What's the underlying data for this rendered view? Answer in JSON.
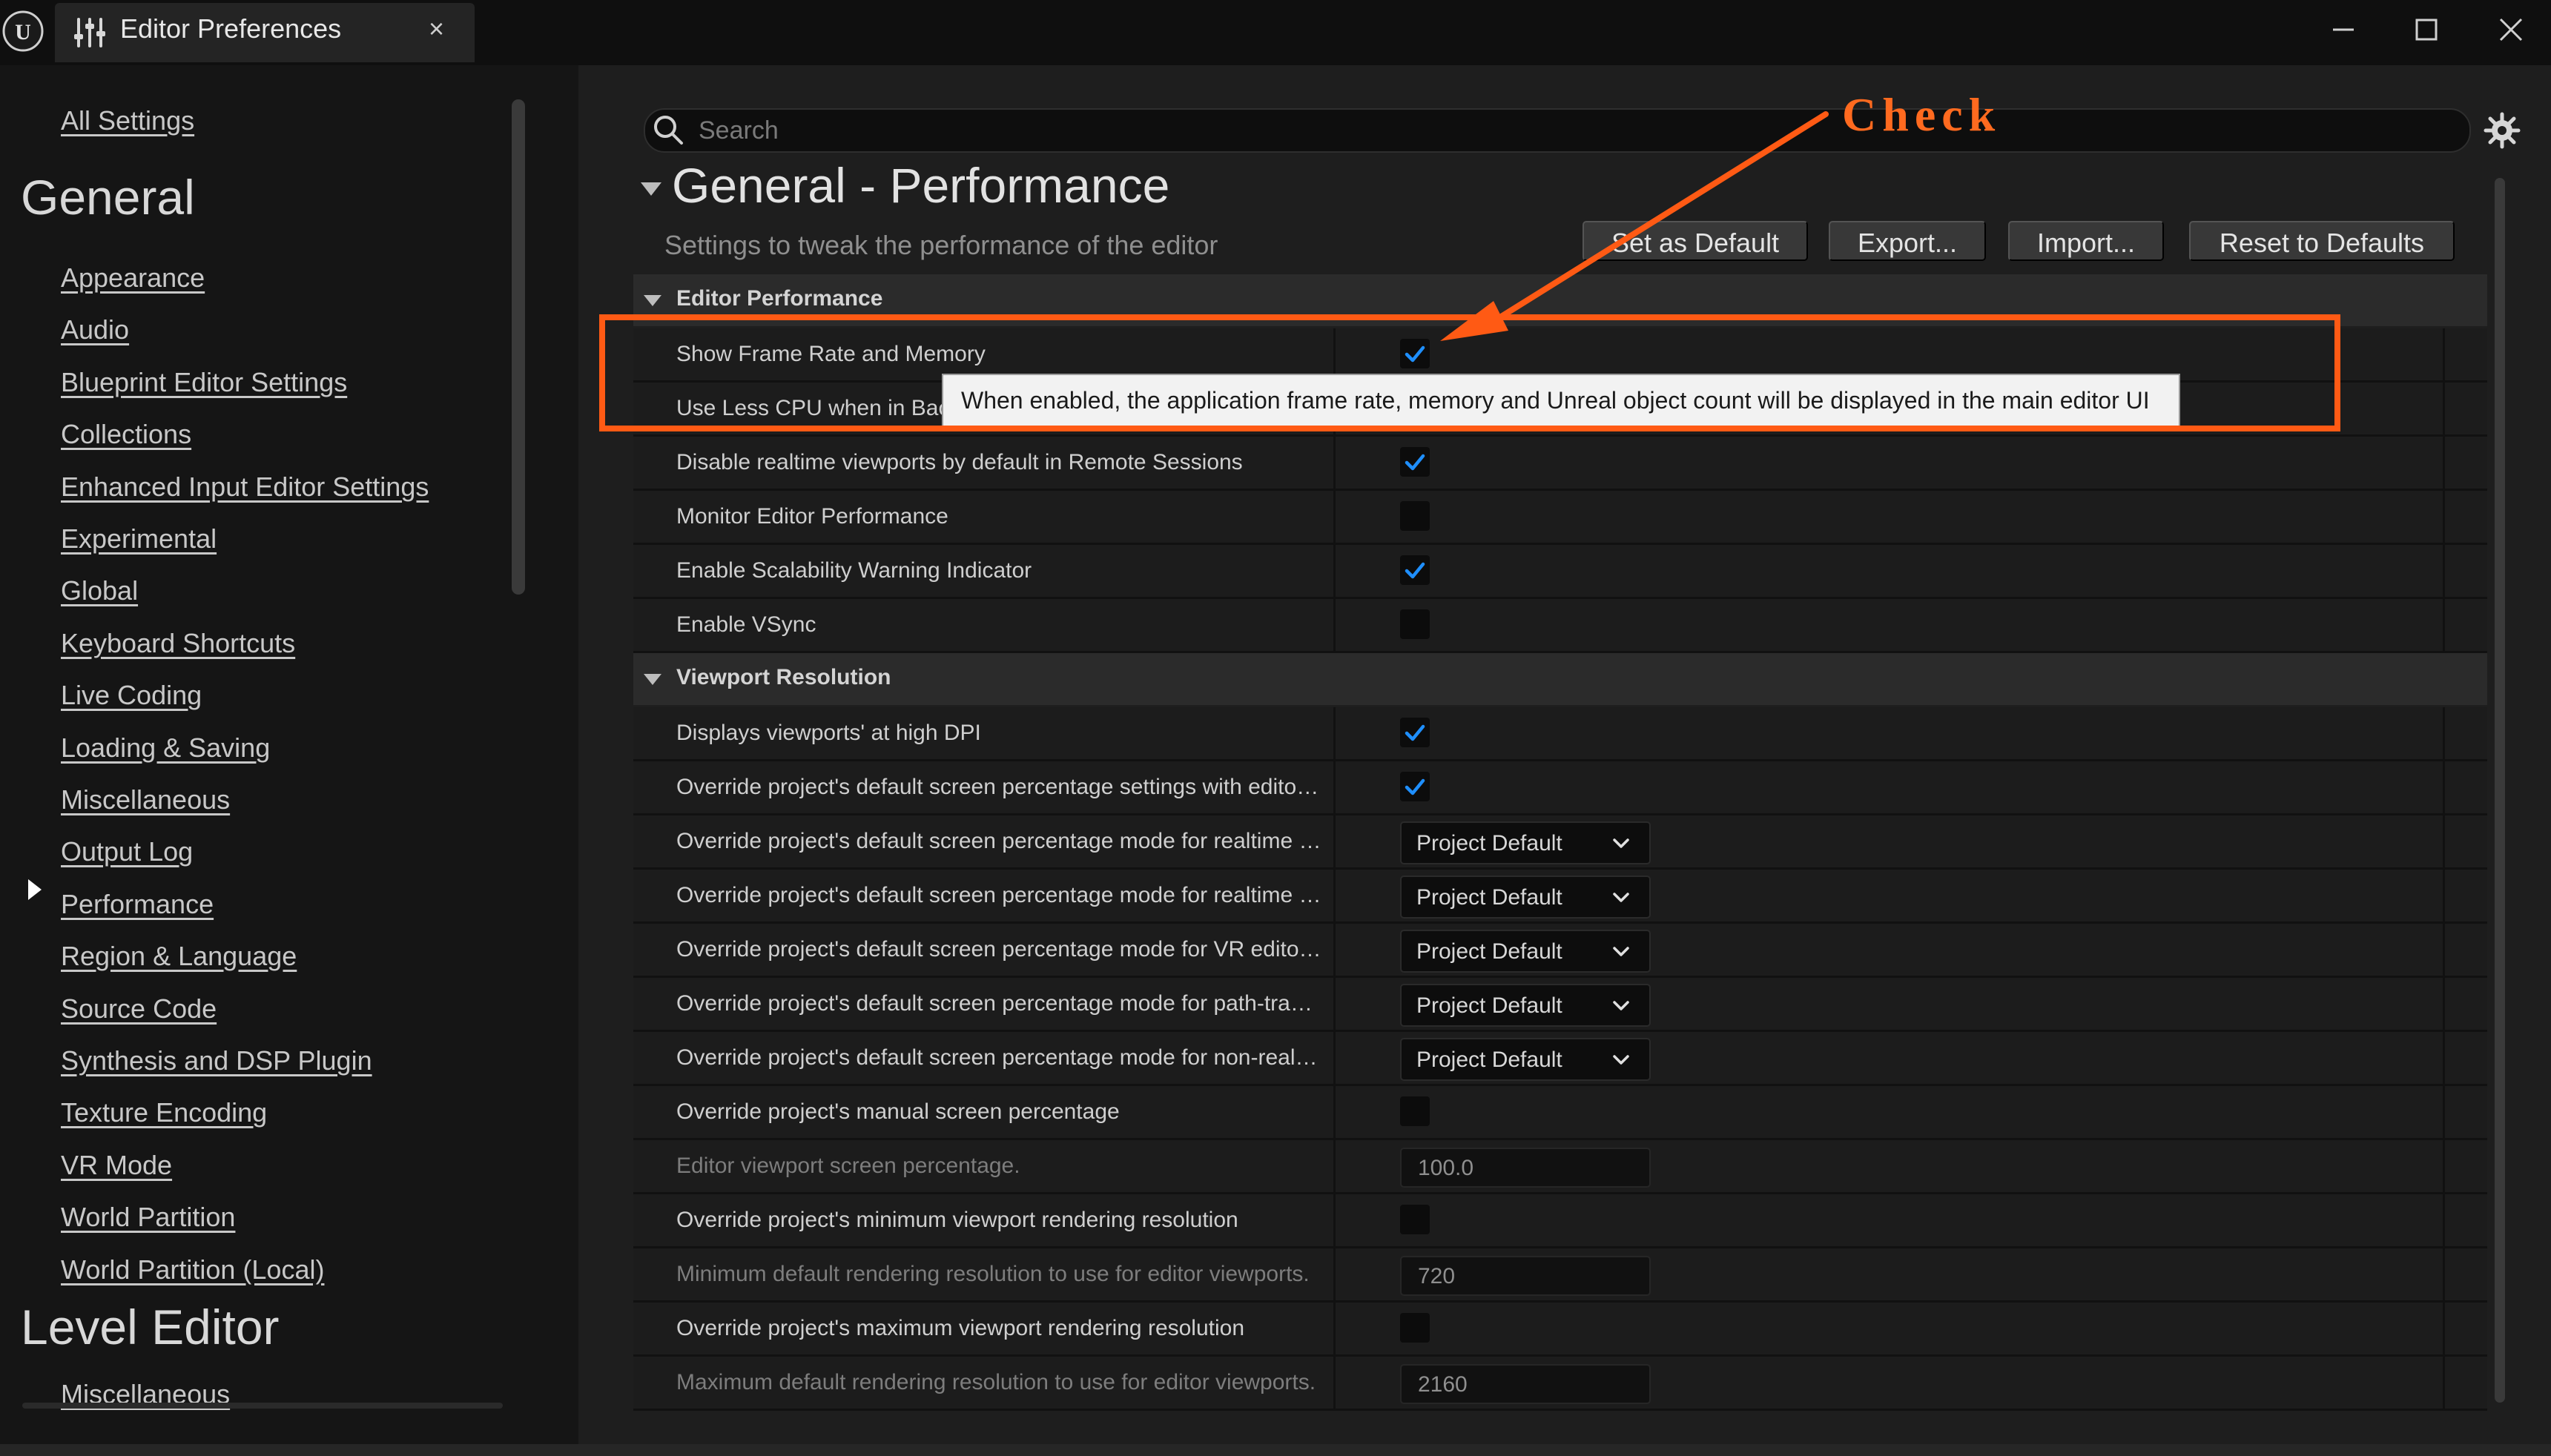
{
  "window": {
    "tab_title": "Editor Preferences",
    "close_glyph": "×"
  },
  "search": {
    "placeholder": "Search"
  },
  "sidebar": {
    "all_settings": "All Settings",
    "general_heading": "General",
    "items": [
      "Appearance",
      "Audio",
      "Blueprint Editor Settings",
      "Collections",
      "Enhanced Input Editor Settings",
      "Experimental",
      "Global",
      "Keyboard Shortcuts",
      "Live Coding",
      "Loading & Saving",
      "Miscellaneous",
      "Output Log",
      "Performance",
      "Region & Language",
      "Source Code",
      "Synthesis and DSP Plugin",
      "Texture Encoding",
      "VR Mode",
      "World Partition",
      "World Partition (Local)"
    ],
    "selected_item": "Performance",
    "level_editor_heading": "Level Editor",
    "level_editor_items": [
      "Miscellaneous"
    ]
  },
  "main": {
    "section_title": "General - Performance",
    "section_desc": "Settings to tweak the performance of the editor",
    "buttons": [
      "Set as Default",
      "Export...",
      "Import...",
      "Reset to Defaults"
    ],
    "categories": [
      {
        "title": "Editor Performance",
        "rows": [
          {
            "label": "Show Frame Rate and Memory",
            "type": "checkbox",
            "checked": true
          },
          {
            "label": "Use Less CPU when in Background",
            "type": "checkbox",
            "checked": false
          },
          {
            "label": "Disable realtime viewports by default in Remote Sessions",
            "type": "checkbox",
            "checked": true
          },
          {
            "label": "Monitor Editor Performance",
            "type": "checkbox",
            "checked": false
          },
          {
            "label": "Enable Scalability Warning Indicator",
            "type": "checkbox",
            "checked": true
          },
          {
            "label": "Enable VSync",
            "type": "checkbox",
            "checked": false
          }
        ]
      },
      {
        "title": "Viewport Resolution",
        "rows": [
          {
            "label": "Displays viewports' at high DPI",
            "type": "checkbox",
            "checked": true
          },
          {
            "label": "Override project's default screen percentage settings with editor viewport settings",
            "type": "checkbox",
            "checked": true
          },
          {
            "label": "Override project's default screen percentage mode for realtime editor viewports",
            "type": "dropdown",
            "value": "Project Default"
          },
          {
            "label": "Override project's default screen percentage mode for realtime editor viewports using desktop renderer",
            "type": "dropdown",
            "value": "Project Default"
          },
          {
            "label": "Override project's default screen percentage mode for VR editor viewports",
            "type": "dropdown",
            "value": "Project Default"
          },
          {
            "label": "Override project's default screen percentage mode for path-traced editor viewports",
            "type": "dropdown",
            "value": "Project Default"
          },
          {
            "label": "Override project's default screen percentage mode for non-realtime editor viewports",
            "type": "dropdown",
            "value": "Project Default"
          },
          {
            "label": "Override project's manual screen percentage",
            "type": "checkbox",
            "checked": false
          },
          {
            "label": "Editor viewport screen percentage.",
            "type": "number",
            "value": "100.0",
            "disabled": true
          },
          {
            "label": "Override project's minimum viewport rendering resolution",
            "type": "checkbox",
            "checked": false
          },
          {
            "label": "Minimum default rendering resolution to use for editor viewports.",
            "type": "number",
            "value": "720",
            "disabled": true
          },
          {
            "label": "Override project's maximum viewport rendering resolution",
            "type": "checkbox",
            "checked": false
          },
          {
            "label": "Maximum default rendering resolution to use for editor viewports.",
            "type": "number",
            "value": "2160",
            "disabled": true
          }
        ]
      }
    ]
  },
  "tooltip": "When enabled, the application frame rate, memory and Unreal object count will be displayed in the main editor UI",
  "annotation": {
    "text": "Check",
    "color": "#ff6a1f"
  },
  "colors": {
    "accent_check": "#1f8fff",
    "highlight": "#ff5a14"
  }
}
